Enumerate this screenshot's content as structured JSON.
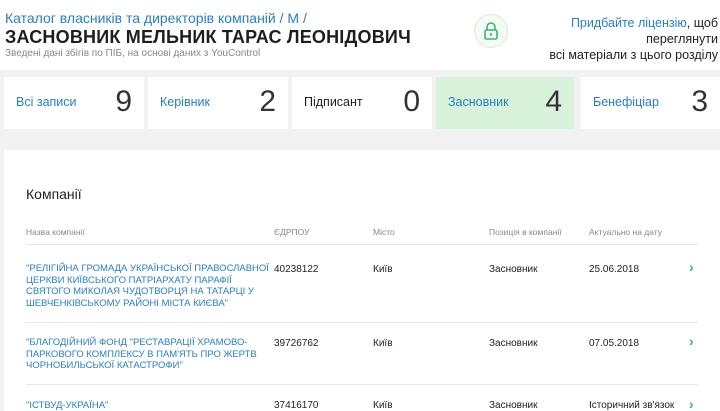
{
  "header": {
    "breadcrumb_catalog": "Каталог власників та директорів компаній /",
    "breadcrumb_letter": "М /",
    "title": "ЗАСНОВНИК МЕЛЬНИК ТАРАС ЛЕОНІДОВИЧ",
    "subtitle": "Зведені дані збігів по ПІБ, на основі даних з YouControl",
    "license_link": "Придбайте ліцензію",
    "license_text1": ", щоб переглянути",
    "license_text2": "всі матеріали з цього розділу",
    "lock_icon": "lock-icon"
  },
  "stats": [
    {
      "label": "Всі записи",
      "count": "9"
    },
    {
      "label": "Керівник",
      "count": "2"
    },
    {
      "label": "Підписант",
      "count": "0"
    },
    {
      "label": "Засновник",
      "count": "4"
    },
    {
      "label": "Бенефіціар",
      "count": "3"
    }
  ],
  "companies": {
    "title": "Компанії",
    "columns": [
      "Назва компанії",
      "ЄДРПОУ",
      "Місто",
      "Позиція в компанії",
      "Актуально на дату"
    ],
    "rows": [
      {
        "name": "\"РЕЛІГІЙНА ГРОМАДА УКРАЇНСЬКОЇ ПРАВОСЛАВНОЇ ЦЕРКВИ КИЇВСЬКОГО ПАТРІАРХАТУ ПАРАФІЇ СВЯТОГО МИКОЛАЯ ЧУДОТВОРЦЯ НА ТАТАРЦІ У ШЕВЧЕНКІВСЬКОМУ РАЙОНІ МІСТА КИЄВА\"",
        "code": "40238122",
        "city": "Київ",
        "position": "Засновник",
        "date": "25.06.2018"
      },
      {
        "name": "\"БЛАГОДІЙНИЙ ФОНД \"РЕСТАВРАЦІЇ ХРАМОВО-ПАРКОВОГО КОМПЛЕКСУ В ПАМ'ЯТЬ ПРО ЖЕРТВ ЧОРНОБИЛЬСЬКОЇ КАТАСТРОФИ\"",
        "code": "39726762",
        "city": "Київ",
        "position": "Засновник",
        "date": "07.05.2018"
      },
      {
        "name": "\"ІСТВУД-УКРАЇНА\"",
        "code": "37416170",
        "city": "Київ",
        "position": "Засновник",
        "date": "Історичний зв'язок"
      }
    ]
  }
}
